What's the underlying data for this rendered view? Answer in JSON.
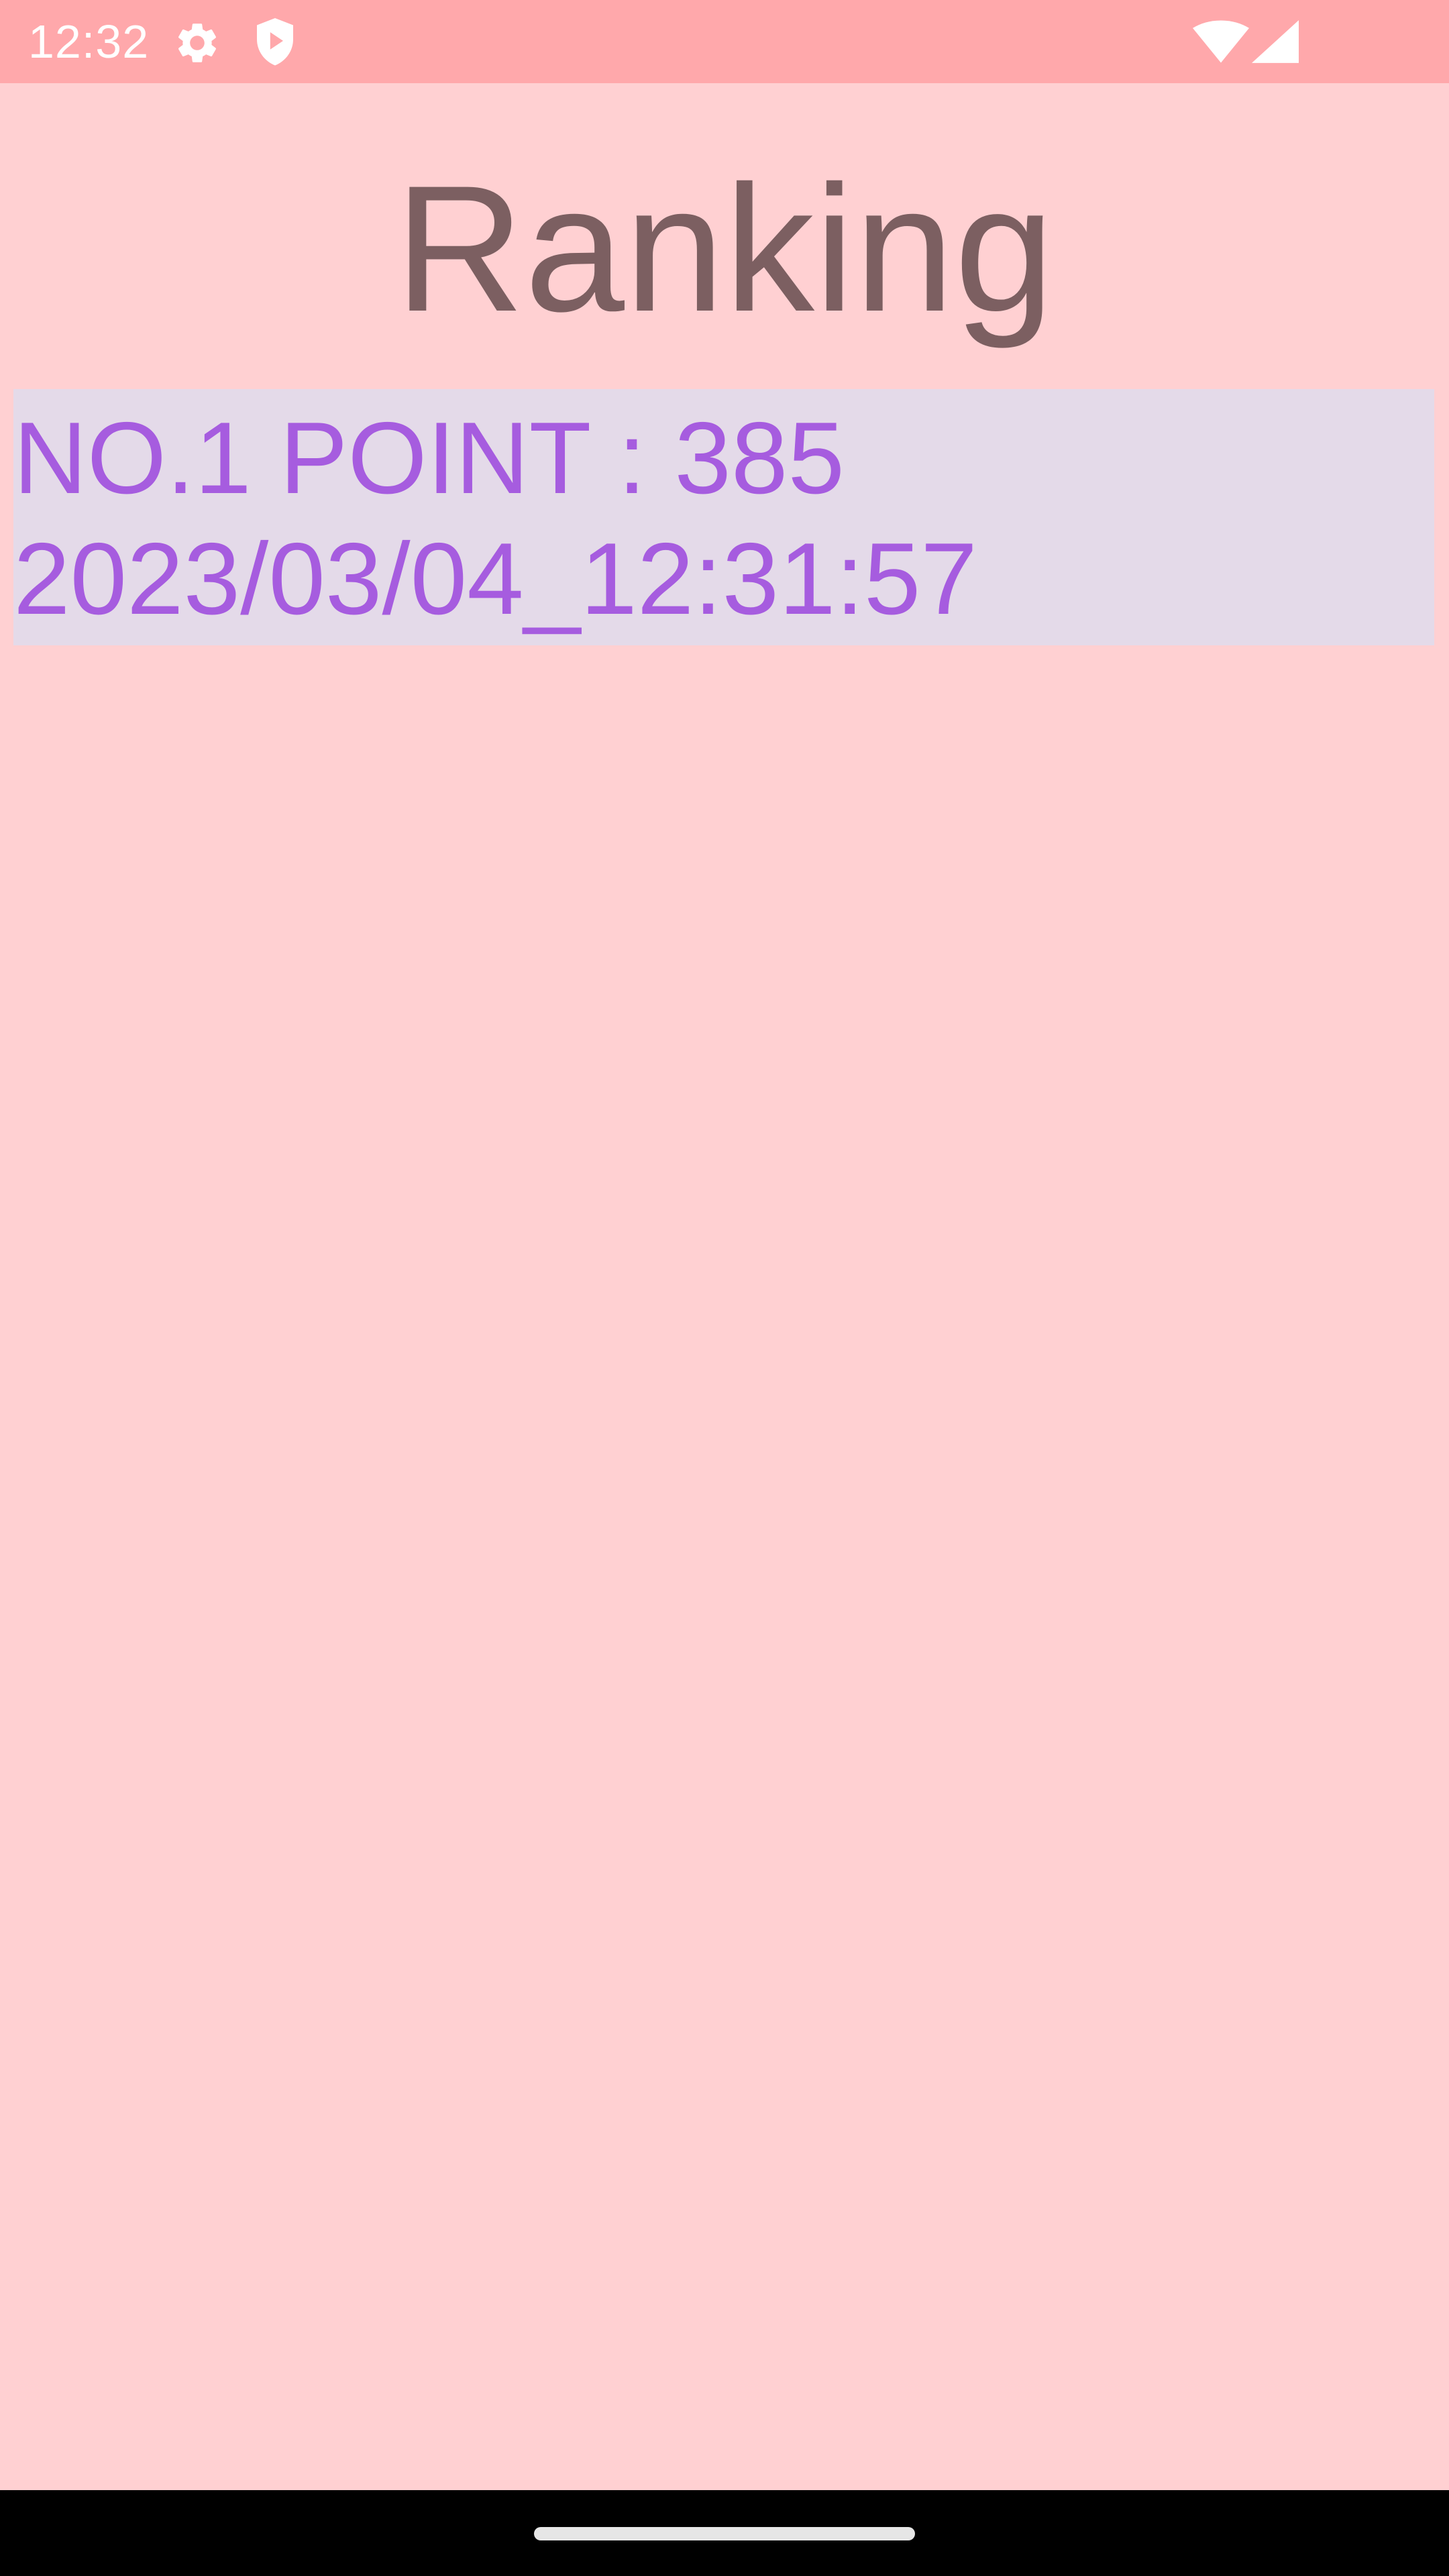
{
  "status_bar": {
    "time": "12:32",
    "icons": [
      "gear-icon",
      "shield-play-icon",
      "wifi-icon",
      "cell-signal-icon"
    ],
    "color": "#FFA8AB"
  },
  "screen": {
    "title": "Ranking",
    "background_color": "#FFD0D2",
    "title_color": "#7C5F61"
  },
  "ranking": {
    "item_background": "#E4DAE9",
    "text_color": "#A65CDF",
    "items": [
      {
        "line1": "NO.1 POINT : 385",
        "line2": "2023/03/04_12:31:57"
      }
    ]
  },
  "nav_bar": {
    "icons": [
      "home-handle"
    ]
  }
}
